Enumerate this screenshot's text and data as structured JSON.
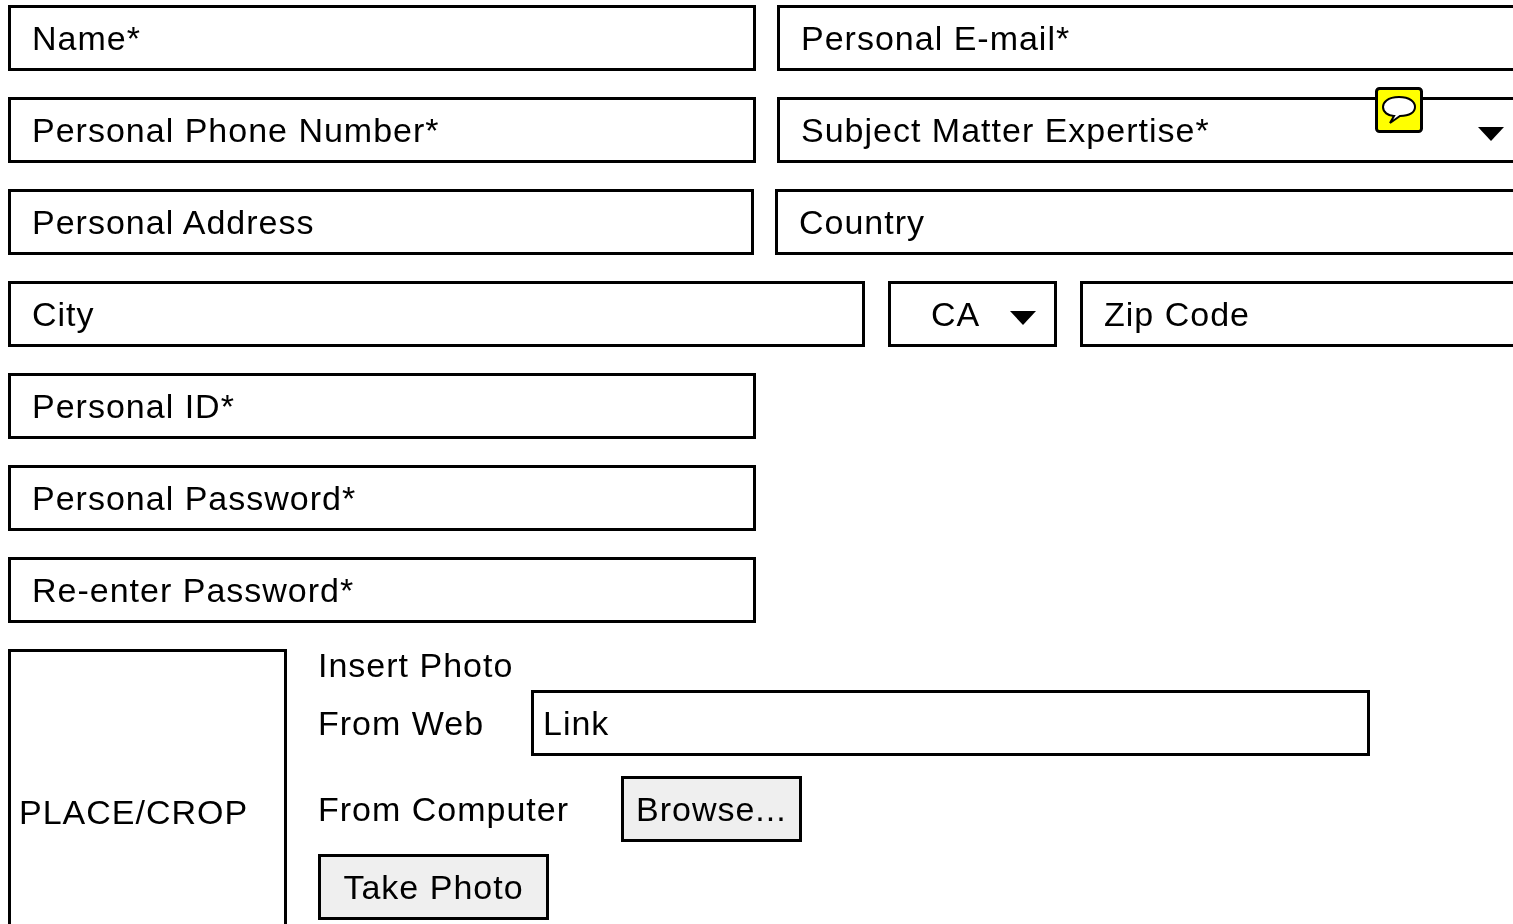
{
  "rows": [
    {
      "fields": [
        {
          "kind": "text",
          "placeholder": "Name*"
        },
        {
          "kind": "text",
          "placeholder": "Personal E-mail*"
        }
      ]
    },
    {
      "fields": [
        {
          "kind": "text",
          "placeholder": "Personal Phone Number*"
        },
        {
          "kind": "dropdown",
          "value": "Subject Matter Expertise*",
          "comment": true
        }
      ]
    },
    {
      "fields": [
        {
          "kind": "text",
          "placeholder": "Personal Address"
        },
        {
          "kind": "text",
          "placeholder": "Country"
        }
      ]
    },
    {
      "fields": [
        {
          "kind": "text",
          "placeholder": "City"
        },
        {
          "kind": "dropdown",
          "value": "CA",
          "comment": false
        },
        {
          "kind": "text",
          "placeholder": "Zip Code"
        }
      ]
    },
    {
      "fields": [
        {
          "kind": "text",
          "placeholder": "Personal ID*"
        }
      ]
    },
    {
      "fields": [
        {
          "kind": "text",
          "placeholder": "Personal Password*"
        }
      ]
    },
    {
      "fields": [
        {
          "kind": "text",
          "placeholder": "Re-enter Password*"
        }
      ]
    }
  ],
  "photo_box": {
    "label": "PLACE/CROP"
  },
  "insert_photo": {
    "title": "Insert Photo",
    "web_label": "From Web",
    "link": {
      "placeholder": "Link"
    },
    "computer_label": "From Computer",
    "browse_button": "Browse...",
    "take_photo_button": "Take Photo"
  }
}
